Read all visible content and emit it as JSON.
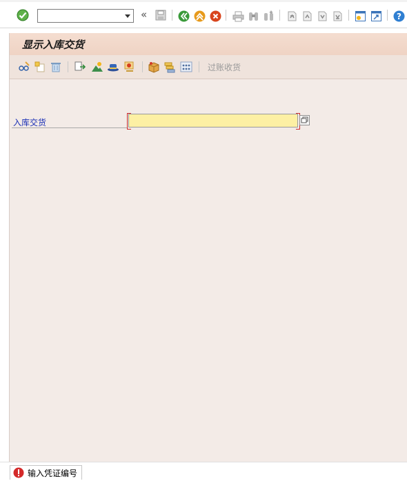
{
  "system_toolbar": {
    "enter_icon": "check-icon",
    "command_field": {
      "value": "",
      "placeholder": ""
    },
    "collapse_glyph": "«",
    "colors": {
      "back": "#3a9a3a",
      "exit": "#e79a1c",
      "cancel": "#d8441c",
      "help": "#2f7fd2"
    }
  },
  "screen": {
    "title": "显示入库交货",
    "toolbar": {
      "post_goods_receipt_label": "过账收货"
    },
    "field": {
      "label": "入库交货",
      "value": ""
    }
  },
  "status": {
    "message": "输入凭证编号",
    "type": "error"
  },
  "colors": {
    "background": "#f3ebe7",
    "title_bar": "#efd3c4",
    "required_field": "#fdf0a4",
    "label": "#1a2fb5"
  }
}
